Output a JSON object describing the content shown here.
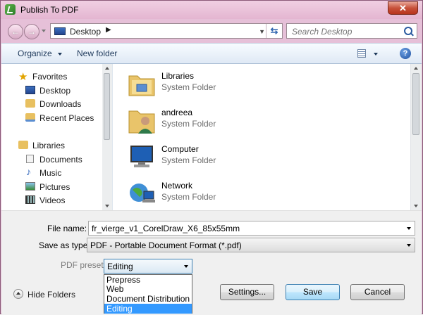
{
  "window": {
    "title": "Publish To PDF",
    "close_label": "✕"
  },
  "nav": {
    "back_label": "←",
    "forward_label": "→",
    "address": "Desktop",
    "address_arrow": "▶",
    "search_placeholder": "Search Desktop"
  },
  "toolbar": {
    "organize": "Organize",
    "new_folder": "New folder",
    "help_label": "?"
  },
  "sidebar": {
    "favorites": "Favorites",
    "fav_items": [
      "Desktop",
      "Downloads",
      "Recent Places"
    ],
    "libraries": "Libraries",
    "lib_items": [
      "Documents",
      "Music",
      "Pictures",
      "Videos"
    ]
  },
  "files": [
    {
      "name": "Libraries",
      "type": "System Folder"
    },
    {
      "name": "andreea",
      "type": "System Folder"
    },
    {
      "name": "Computer",
      "type": "System Folder"
    },
    {
      "name": "Network",
      "type": "System Folder"
    }
  ],
  "form": {
    "filename_label": "File name:",
    "filename_value": "fr_vierge_v1_CorelDraw_X6_85x55mm",
    "savetype_label": "Save as type:",
    "savetype_value": "PDF - Portable Document Format (*.pdf)",
    "preset_label": "PDF preset:",
    "preset_value": "Editing",
    "preset_options": [
      "Prepress",
      "Web",
      "Document Distribution",
      "Editing"
    ]
  },
  "buttons": {
    "hide_folders": "Hide Folders",
    "settings": "Settings...",
    "save": "Save",
    "cancel": "Cancel"
  },
  "colors": {
    "frame": "#e6c0d8",
    "toolbar": "#dfe9f5",
    "selection": "#3399ff"
  }
}
